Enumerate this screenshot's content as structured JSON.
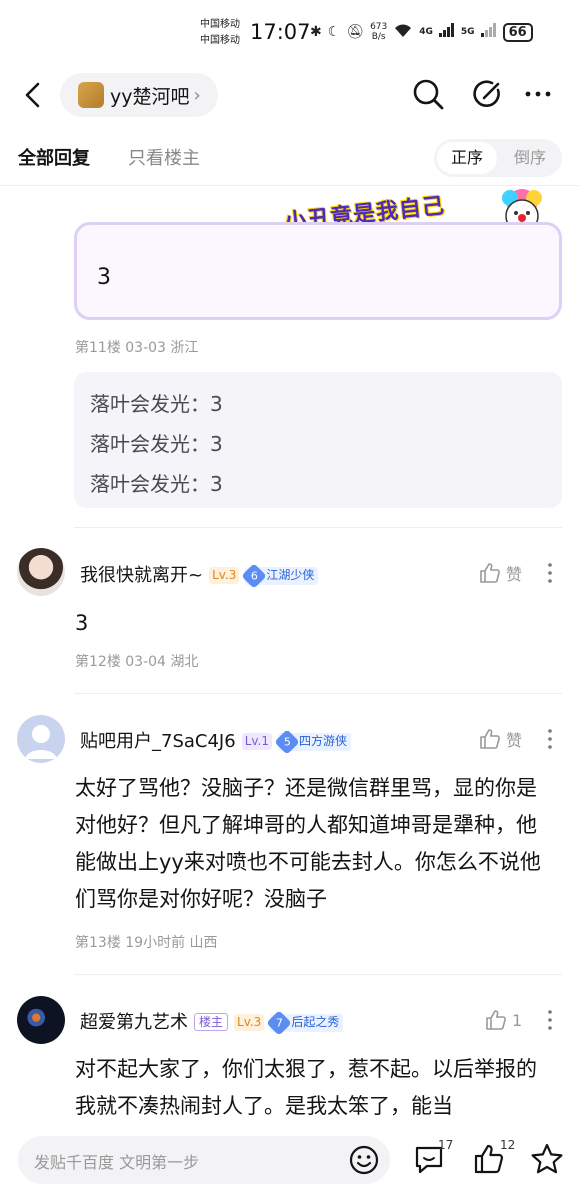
{
  "status_bar": {
    "carrier_1": "中国移动",
    "carrier_2": "中国移动",
    "time": "17:07",
    "speed_value": "673",
    "speed_unit": "B/s",
    "net_1": "4G",
    "net_2": "5G",
    "battery": "66"
  },
  "nav": {
    "forum_name": "yy楚河吧",
    "forum_chevron": "›"
  },
  "tabs": {
    "all_replies": "全部回复",
    "only_op": "只看楼主",
    "order_asc": "正序",
    "order_desc": "倒序"
  },
  "sticker": {
    "text": "小丑竟是我自己"
  },
  "floor11": {
    "content": "3",
    "meta": "第11楼  03-03  浙江",
    "subreplies": [
      {
        "text": "落叶会发光：3"
      },
      {
        "text": "落叶会发光：3"
      },
      {
        "text": "落叶会发光：3"
      }
    ]
  },
  "posts": [
    {
      "username": "我很快就离开~",
      "level": "Lv.3",
      "title_num": "6",
      "title": "江湖少侠",
      "like_label": "赞",
      "content": "3",
      "meta": "第12楼  03-04  湖北"
    },
    {
      "username": "贴吧用户_7SaC4J6",
      "level": "Lv.1",
      "title_num": "5",
      "title": "四方游侠",
      "like_label": "赞",
      "content": "太好了骂他？没脑子？还是微信群里骂，显的你是对他好？但凡了解坤哥的人都知道坤哥是犟种，他能做出上yy来对喷也不可能去封人。你怎么不说他们骂你是对你好呢？没脑子",
      "meta": "第13楼  19小时前  山西"
    },
    {
      "username": "超爱第九艺术",
      "op_badge": "楼主",
      "level": "Lv.3",
      "title_num": "7",
      "title": "后起之秀",
      "like_label": "1",
      "content": "对不起大家了，你们太狠了，惹不起。以后举报的我就不凑热闹封人了。是我太笨了，能当"
    }
  ],
  "bottom_bar": {
    "placeholder": "发贴千百度 文明第一步",
    "comment_count": "17",
    "like_count": "12"
  },
  "colors": {
    "accent_purple": "#7b5cd6",
    "title_blue": "#2a62d8",
    "level_orange": "#d98a1a"
  }
}
